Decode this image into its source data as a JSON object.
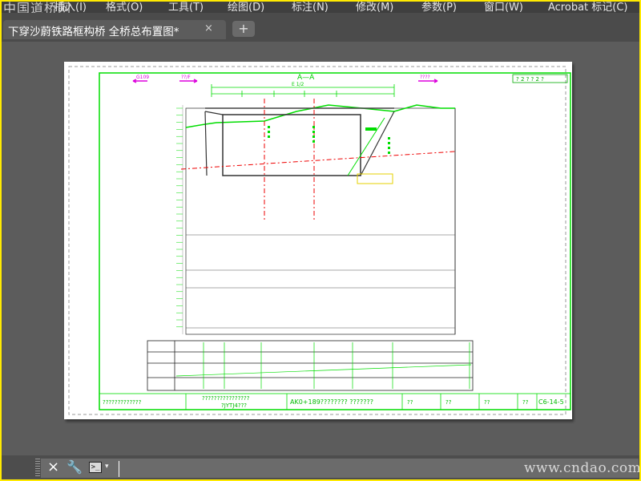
{
  "menubar": {
    "logo": "中国道桥网",
    "items": [
      {
        "label": "插入(I)"
      },
      {
        "label": "格式(O)"
      },
      {
        "label": "工具(T)"
      },
      {
        "label": "绘图(D)"
      },
      {
        "label": "标注(N)"
      },
      {
        "label": "修改(M)"
      },
      {
        "label": "参数(P)"
      },
      {
        "label": "窗口(W)"
      },
      {
        "label": "Acrobat 标记(C)"
      }
    ]
  },
  "tabs": {
    "active_title": "下穿沙蔚铁路框构桥 全桥总布置图*",
    "close_glyph": "×",
    "add_glyph": "+"
  },
  "drawing": {
    "section_label": "A—A",
    "section_sublabel": "E 1/2",
    "left_arrow_label": "G109",
    "left_arrow2_label": "??/F",
    "right_arrow_label": "????",
    "corner_box": "? 2 ?  ? 2 ?",
    "title_block": {
      "left": "?????????????",
      "middle_line1": "????????????????",
      "middle_line2": "?JYTJ4???",
      "drawing_no": "AK0+189????????  ???????",
      "c1": "??",
      "c2": "??",
      "c3": "??",
      "c4": "??",
      "sheet": "C6-14-5"
    }
  },
  "command": {
    "close_icon": "×",
    "wrench_icon": "🔧",
    "prompt_glyph": ">_",
    "caret_glyph": "▾",
    "input_value": ""
  },
  "watermark": "www.cndao.com",
  "colors": {
    "drawing_green": "#00dd00",
    "dimension_magenta": "#dd00dd",
    "axis_red": "#ee0000",
    "frame_yellow": "#ffea00"
  }
}
